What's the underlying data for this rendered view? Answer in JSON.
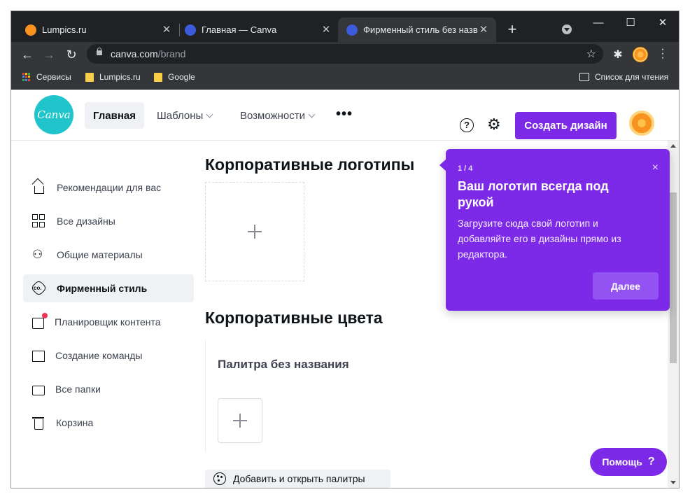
{
  "browser": {
    "tabs": [
      {
        "title": "Lumpics.ru",
        "favicon_color": "#f7931e",
        "active": false
      },
      {
        "title": "Главная — Canva",
        "favicon_color": "#3b5bdb",
        "active": false
      },
      {
        "title": "Фирменный стиль без назван",
        "favicon_color": "#3b5bdb",
        "active": true
      }
    ],
    "window_controls": {
      "minimize": "—",
      "maximize": "☐",
      "close": "✕"
    },
    "url": {
      "host": "canva.com",
      "path": "/brand"
    },
    "bookmarks": [
      {
        "label": "Сервисы",
        "icon": "apps-icon"
      },
      {
        "label": "Lumpics.ru",
        "icon": "folder-icon"
      },
      {
        "label": "Google",
        "icon": "folder-icon"
      }
    ],
    "reading_list": "Список для чтения"
  },
  "header": {
    "logo_text": "Canva",
    "nav": [
      {
        "label": "Главная",
        "active": true
      },
      {
        "label": "Шаблоны",
        "dropdown": true
      },
      {
        "label": "Возможности",
        "dropdown": true
      }
    ],
    "more": "•••",
    "help_icon_text": "?",
    "create_button": "Создать дизайн"
  },
  "sidebar": {
    "items": [
      {
        "label": "Рекомендации для вас",
        "icon": "home-icon",
        "active": false
      },
      {
        "label": "Все дизайны",
        "icon": "grid-icon",
        "active": false
      },
      {
        "label": "Общие материалы",
        "icon": "people-icon",
        "active": false
      },
      {
        "label": "Фирменный стиль",
        "icon": "brand-kit-icon",
        "active": true
      },
      {
        "label": "Планировщик контента",
        "icon": "calendar-icon",
        "active": false
      },
      {
        "label": "Создание команды",
        "icon": "team-icon",
        "active": false
      },
      {
        "label": "Все папки",
        "icon": "folder-icon",
        "active": false
      },
      {
        "label": "Корзина",
        "icon": "trash-icon",
        "active": false
      }
    ],
    "brand_icon_text": "co."
  },
  "main": {
    "logos_heading": "Корпоративные логотипы",
    "colors_heading": "Корпоративные цвета",
    "palette_name": "Палитра без названия",
    "add_palettes": "Добавить и открыть палитры"
  },
  "popover": {
    "step": "1 / 4",
    "title": "Ваш логотип всегда под рукой",
    "body": "Загрузите сюда свой логотип и добавляйте его в дизайны прямо из редактора.",
    "close": "×",
    "next": "Далее"
  },
  "help_button": {
    "label": "Помощь",
    "icon": "?"
  },
  "colors": {
    "accent": "#7d2ae8",
    "logo": "#20c4cb",
    "chrome_dark": "#202124",
    "chrome_toolbar": "#35363a"
  }
}
